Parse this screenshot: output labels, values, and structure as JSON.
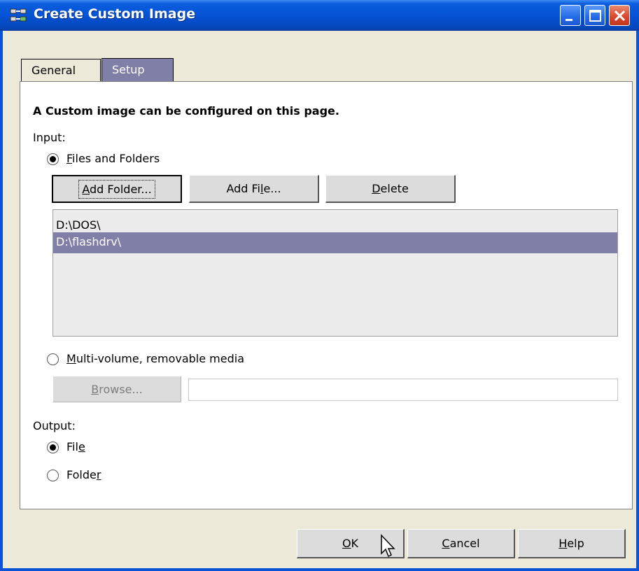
{
  "window": {
    "title": "Create Custom Image"
  },
  "tabs": [
    {
      "label": "General",
      "active": false
    },
    {
      "label": "Setup",
      "active": true
    }
  ],
  "setup": {
    "heading": "A Custom image can be configured on this page.",
    "input_label": "Input:",
    "files_option": {
      "first": "F",
      "rest": "iles and Folders",
      "selected": true
    },
    "buttons": {
      "add_folder": {
        "first": "A",
        "rest": "dd Folder..."
      },
      "add_file": {
        "before": "Add Fi",
        "mnemonic": "l",
        "after": "e..."
      },
      "delete": {
        "first": "D",
        "rest": "elete"
      }
    },
    "list_items": [
      {
        "path": "D:\\DOS\\",
        "selected": false
      },
      {
        "path": "D:\\flashdrv\\",
        "selected": true
      }
    ],
    "multivolume_option": {
      "first": "M",
      "rest": "ulti-volume, removable media",
      "selected": false
    },
    "browse": {
      "first": "B",
      "rest": "rowse...",
      "disabled": true
    },
    "browse_path_value": "",
    "output_label": "Output:",
    "output_file": {
      "before": "Fil",
      "mnemonic": "e",
      "selected": true
    },
    "output_folder": {
      "before": "Folde",
      "mnemonic": "r",
      "selected": false
    }
  },
  "footer": {
    "ok": {
      "first": "O",
      "rest": "K"
    },
    "cancel": {
      "first": "C",
      "rest": "ancel"
    },
    "help": {
      "first": "H",
      "rest": "elp"
    }
  },
  "colors": {
    "titlebar": "#0553d6",
    "selected_bg": "#7f7fa8",
    "face": "#ece9d8"
  }
}
